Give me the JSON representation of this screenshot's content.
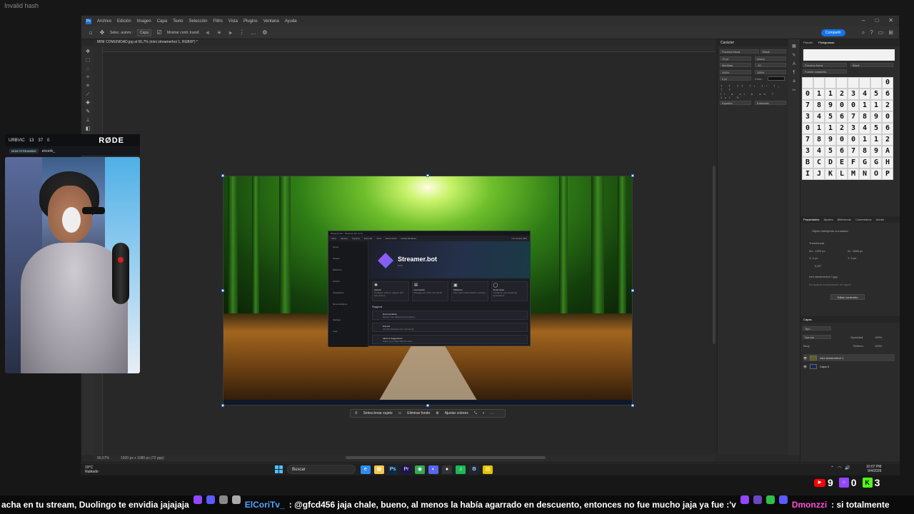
{
  "top_label": "Invalid hash",
  "photoshop": {
    "menu": [
      "Archivo",
      "Edición",
      "Imagen",
      "Capa",
      "Texto",
      "Selección",
      "Filtro",
      "Vista",
      "Plugins",
      "Ventana",
      "Ayuda"
    ],
    "options": {
      "select_label": "Selec. autom.:",
      "layer_chip": "Capa",
      "transform_label": "Mostrar contr. transf.",
      "share_button": "Compartir"
    },
    "document_tab": "MINI COMUNIDAD.jpg al 66,7% (mini streamerbot 1, RGB/8*) *",
    "status": {
      "zoom": "66,67%",
      "size": "1920 px x 1080 px (72 ppp)"
    },
    "context_bar": {
      "select_subject": "Seleccionar sujeto",
      "remove_bg": "Eliminar fondo",
      "adjust_colors": "Ajustar colores"
    },
    "character_panel": {
      "title": "Carácter",
      "font": "Proxima Nova",
      "style": "Black",
      "size": "75 pt",
      "leading": "(Auto)",
      "kerning": "Medidas",
      "tracking": "-10",
      "vscale": "100%",
      "hscale": "100%",
      "baseline": "0 pt",
      "color_label": "Color:",
      "language": "Español",
      "aa": "Enfocado"
    },
    "glyph_panel": {
      "tabs": [
        "Párrafo",
        "Pictogramas"
      ],
      "font": "Proxima Nova",
      "style": "Black",
      "set": "Fuente completa",
      "glyphs": [
        "",
        "",
        "",
        "",
        "",
        "",
        "",
        "0",
        "0",
        "1",
        "1",
        "2",
        "3",
        "4",
        "5",
        "6",
        "7",
        "8",
        "9",
        "0",
        "0",
        "1",
        "1",
        "2",
        "3",
        "4",
        "5",
        "6",
        "7",
        "8",
        "9",
        "0",
        "0",
        "1",
        "1",
        "2",
        "3",
        "4",
        "5",
        "6",
        "7",
        "8",
        "9",
        "0",
        "0",
        "1",
        "1",
        "2",
        "3",
        "4",
        "5",
        "6",
        "7",
        "8",
        "9",
        "A",
        "B",
        "C",
        "D",
        "E",
        "F",
        "G",
        "G",
        "H",
        "I",
        "J",
        "K",
        "L",
        "M",
        "N",
        "O",
        "P"
      ]
    },
    "properties_panel": {
      "tabs": [
        "Propiedades",
        "Ajustes",
        "Bibliotecas",
        "Comentarios",
        "Adobe"
      ],
      "object_type": "Objeto inteligente incrustado",
      "transform": "Transformar",
      "w": "An.: 1920 px",
      "h": "Al.: 1080 px",
      "x": "X: 0 px",
      "y": "Y: 0 px",
      "angle": "0,00°",
      "file": "mini streamerbot 1.jpg",
      "comp": "No aplicar composición de capas",
      "edit_button": "Editar contenido"
    },
    "layers_panel": {
      "title": "Capas",
      "filter": "Tipo",
      "blend": "Normal",
      "opacity_label": "Opacidad:",
      "opacity": "100%",
      "lock_label": "Bloq.:",
      "fill_label": "Relleno:",
      "fill": "100%",
      "layers": [
        {
          "name": "mini streamerbot 1"
        },
        {
          "name": "Capa 0"
        }
      ]
    },
    "streamerbot": {
      "window_title": "Streamer.bot - Streamer.bot 0.2.6",
      "menu": [
        "Inicio",
        "Ajustes",
        "Importar",
        "Exportar",
        "Chat",
        "Event Hook",
        "Global Variables",
        "Connected (0/0)"
      ],
      "name": "Streamer.bot",
      "version": "0.2.6",
      "sidebar": [
        "Home",
        "Stream",
        "Platforms",
        "Actions",
        "Integrations",
        "Servers/Clients",
        "Settings",
        "Logs"
      ],
      "cards": [
        {
          "icon": "✱",
          "title": "Actions",
          "desc": "Configure actions, triggers and sub-actions"
        },
        {
          "icon": "⌘",
          "title": "Commands",
          "desc": "Manage your chat commands"
        },
        {
          "icon": "▣",
          "title": "Platforms",
          "desc": "View and modify platform settings"
        },
        {
          "icon": "◯",
          "title": "Smart Apps",
          "desc": "Configure your streaming applications"
        }
      ],
      "support_title": "Support",
      "support": [
        {
          "title": "Documentation",
          "desc": "Explore the official documentation"
        },
        {
          "title": "Discord",
          "desc": "Join the Streamer.bot community"
        },
        {
          "title": "Ideas & Suggestions",
          "desc": "Share your ideas with the team"
        }
      ]
    }
  },
  "webcam": {
    "brand": "URBVIC",
    "stats": [
      "13",
      "37",
      "0"
    ],
    "mic_brand": "RØDE",
    "live_tag": "NOW STREAMING",
    "handle": "elcorilv_"
  },
  "taskbar": {
    "weather_temp": "19°C",
    "weather_desc": "Nublado",
    "search": "Buscar",
    "apps": [
      {
        "name": "edge",
        "color": "#2d8cf0",
        "icon": "e"
      },
      {
        "name": "explorer",
        "color": "#f2c94c",
        "icon": "▦"
      },
      {
        "name": "photoshop",
        "color": "#0b2a4a",
        "icon": "Ps"
      },
      {
        "name": "premiere",
        "color": "#1b1450",
        "icon": "Pr"
      },
      {
        "name": "chrome",
        "color": "#34a853",
        "icon": "◉"
      },
      {
        "name": "discord",
        "color": "#5865f2",
        "icon": "◐"
      },
      {
        "name": "obs",
        "color": "#333333",
        "icon": "●"
      },
      {
        "name": "spotify",
        "color": "#1db954",
        "icon": "♫"
      },
      {
        "name": "steam",
        "color": "#1b2838",
        "icon": "⚙"
      },
      {
        "name": "notes",
        "color": "#e6c200",
        "icon": "▤"
      }
    ],
    "time": "10:07 PM",
    "date": "9/4/2026"
  },
  "counters": {
    "youtube": "9",
    "twitch": "0",
    "kick": "3"
  },
  "chat": {
    "text1": "acha en tu stream, Duolingo te envidia jajajaja",
    "user1": "ElCoriTv_",
    "text2": ": @gfcd456 jaja chale, bueno, al menos la había agarrado en descuento, entonces no fue mucho jaja ya fue :'v",
    "user2": "Dmonzzi",
    "text3": ": si totalmente"
  },
  "colors": {
    "accent_blue": "#1473e6",
    "youtube": "#ff0000",
    "twitch": "#9146ff",
    "kick": "#53fc18"
  }
}
